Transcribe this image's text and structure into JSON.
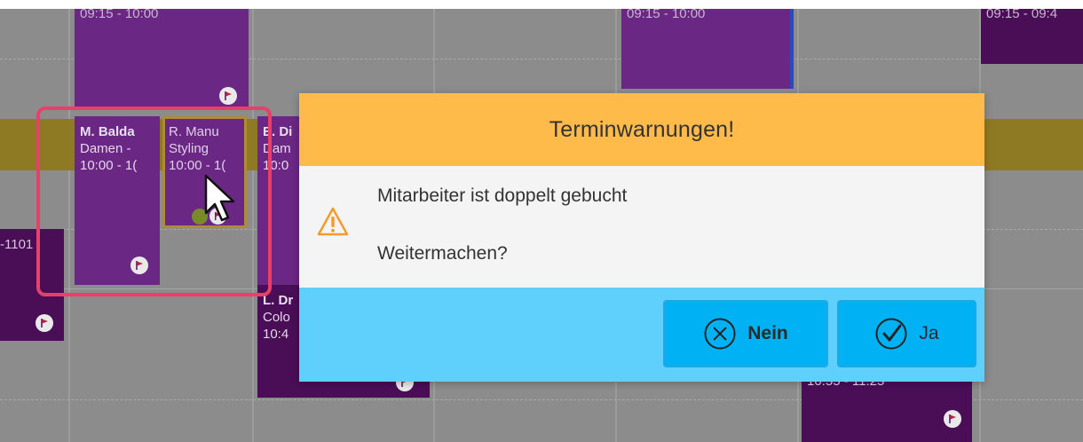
{
  "calendar": {
    "top_times": [
      "09:15 - 10:00",
      "09:15 - 10:00",
      "09:15 - 09:4"
    ],
    "appointments": [
      {
        "lines": [
          "M. Balda",
          "Damen -",
          "10:00 - 1("
        ]
      },
      {
        "lines": [
          "R. Manu",
          "Styling",
          "10:00 - 1("
        ]
      },
      {
        "lines": [
          "E. Di",
          "Dam",
          "10:0"
        ]
      },
      {
        "lines": [
          "L. Dr",
          "Colo",
          "10:4"
        ]
      },
      {
        "lines": [
          "10:55 - 11:25"
        ]
      }
    ],
    "left_partial_label": "-1101",
    "icons": [
      "flag-icon",
      "mouse-cursor-icon"
    ]
  },
  "dialog": {
    "title": "Terminwarnungen!",
    "message": "Mitarbeiter ist doppelt gebucht",
    "question": "Weitermachen?",
    "buttons": {
      "no_label": "Nein",
      "yes_label": "Ja"
    },
    "icons": [
      "warning-icon",
      "close-circle-icon",
      "check-circle-icon"
    ]
  },
  "colors": {
    "dialog_header": "#ffbb4a",
    "dialog_body": "#f4f4f4",
    "dialog_footer": "#5fd0fb",
    "button_bg": "#00b1f4",
    "warning_icon": "#f59a2b",
    "highlight_frame": "#ea3e6b",
    "appointment_purple": "#6a2784"
  }
}
